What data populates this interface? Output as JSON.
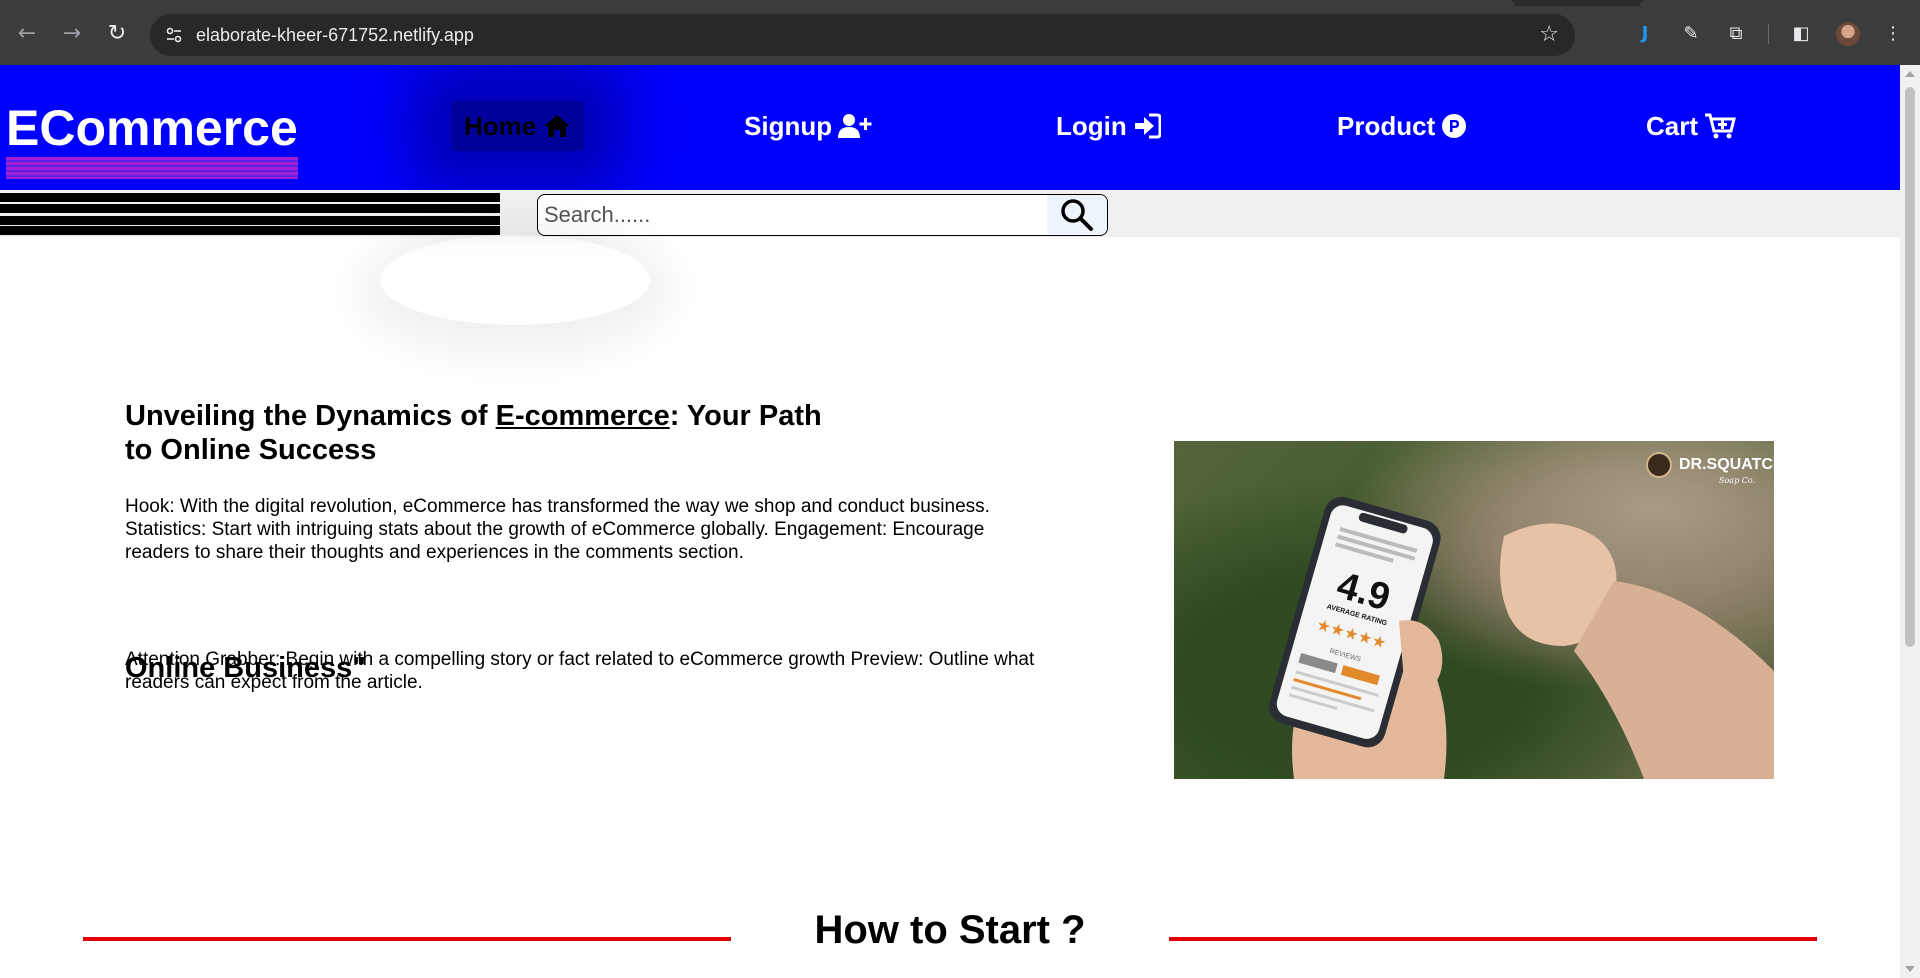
{
  "browser": {
    "url": "elaborate-kheer-671752.netlify.app",
    "back_icon": "arrow-left-icon",
    "forward_icon": "arrow-right-icon",
    "reload_icon": "reload-icon",
    "bookmark_icon": "star-icon"
  },
  "header": {
    "logo": "ECommerce",
    "nav": [
      {
        "label": "Home",
        "icon": "home-icon"
      },
      {
        "label": "Signup",
        "icon": "user-plus-icon"
      },
      {
        "label": "Login",
        "icon": "sign-in-icon"
      },
      {
        "label": "Product",
        "icon": "product-p-icon"
      },
      {
        "label": "Cart",
        "icon": "cart-icon"
      }
    ]
  },
  "search": {
    "placeholder": "Search......"
  },
  "hero": {
    "title_prefix": "Unveiling the Dynamics of ",
    "title_link": "E-commerce",
    "title_suffix": ": Your Path to Online Success",
    "paragraph1": "Hook: With the digital revolution, eCommerce has transformed the way we shop and conduct business. Statistics: Start with intriguing stats about the growth of eCommerce globally. Engagement: Encourage readers to share their thoughts and experiences in the comments section.",
    "subheading": "Online Business\"",
    "paragraph2": "Attention Grabber: Begin with a compelling story or fact related to eCommerce growth Preview: Outline what readers can expect from the article.",
    "image": {
      "brand": "DR.SQUATCH",
      "brand_sub": "Soap Co.",
      "rating": "4.9",
      "rating_caption": "AVERAGE RATING",
      "reviews_label": "REVIEWS"
    }
  },
  "section": {
    "title": "How to Start ?"
  },
  "colors": {
    "header_bg": "#0000ff",
    "accent_line": "#e00000",
    "logo_bar": "#a21fd6"
  }
}
